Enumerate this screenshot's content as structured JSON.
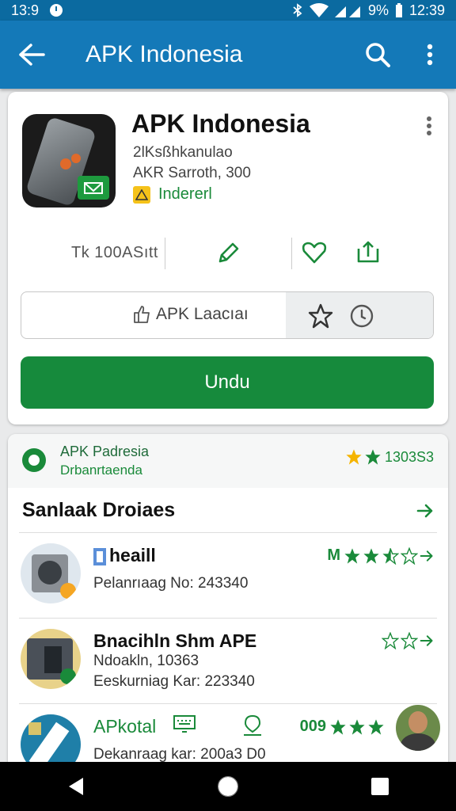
{
  "status_bar": {
    "time_left": "13:9",
    "battery": "9%",
    "time_right": "12:39"
  },
  "app_bar": {
    "title": "APK Indonesia"
  },
  "app_card": {
    "title": "APK Indonesia",
    "line1": "2lKsßhkanulao",
    "line2": "AKR Sarroth, 300",
    "installed_label": "Indererl",
    "stat_text": "Tk 100ASıtt",
    "action_label": "APK Laacıaı",
    "download_label": "Undu"
  },
  "related": {
    "source_name": "APK Padresia",
    "source_dev": "Drbanrtaenda",
    "source_rating": "1303S3",
    "section_title": "Sanlaak Droiaes",
    "items": [
      {
        "title": "heaill",
        "line1": "Pelanrıaag No: 243340",
        "line2": "",
        "pre": "M"
      },
      {
        "title": "Bnacihln Shm APE",
        "line1": "Ndoakln, 10363",
        "line2": "Eeskurniag Kar: 223340",
        "pre": ""
      },
      {
        "title": "APkotal",
        "line1": "Dekanraag kar: 200a3 D0",
        "line2": "",
        "pre": "009"
      }
    ]
  },
  "colors": {
    "app_bar": "#1479b8",
    "status_bar": "#0b6aa0",
    "primary_green": "#168a3c",
    "star_yellow": "#f5b400"
  }
}
